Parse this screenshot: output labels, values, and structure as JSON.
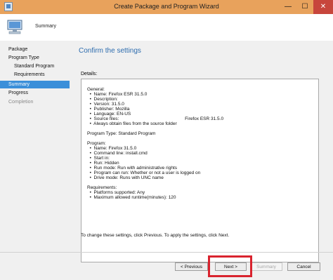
{
  "window": {
    "title": "Create Package and Program Wizard",
    "controls": {
      "minimize": "—",
      "maximize": "☐",
      "close": "✕"
    }
  },
  "header": {
    "icon": "computer-icon",
    "label": "Summary"
  },
  "nav": {
    "items": [
      {
        "label": "Package",
        "state": "normal"
      },
      {
        "label": "Program Type",
        "state": "normal"
      },
      {
        "label": "Standard Program",
        "state": "normal"
      },
      {
        "label": "Requirements",
        "state": "normal"
      },
      {
        "label": "Summary",
        "state": "active"
      },
      {
        "label": "Progress",
        "state": "normal"
      },
      {
        "label": "Completion",
        "state": "disabled"
      }
    ]
  },
  "main": {
    "title": "Confirm the settings",
    "details_label": "Details:",
    "details_text": "General:\n  •  Name: Firefox ESR 31.5.0\n  •  Description:\n  •  Version: 31.5.0\n  •  Publisher: Mozilla\n  •  Language: EN-US\n  •  Source files:                                                    Firefox ESR 31.5.0\n  •  Always obtain files from the source folder\n\nProgram Type: Standard Program\n\nProgram:\n  •  Name: Firefox 31.5.0\n  •  Command line: install.cmd\n  •  Start in:\n  •  Run: Hidden\n  •  Run mode: Run with administrative rights\n  •  Program can run: Whether or not a user is logged on\n  •  Drive mode: Runs with UNC name\n\nRequirements:\n  •  Platforms supported: Any\n  •  Maximum allowed runtime(minutes): 120",
    "footer_note": "To change these settings, click Previous. To apply the settings, click Next."
  },
  "buttons": {
    "previous": "< Previous",
    "next": "Next >",
    "summary": "Summary",
    "cancel": "Cancel"
  },
  "colors": {
    "titlebar": "#e8a25c",
    "accent_title": "#2d6cae",
    "nav_active": "#3b8fd9",
    "highlight": "#d9232e"
  }
}
